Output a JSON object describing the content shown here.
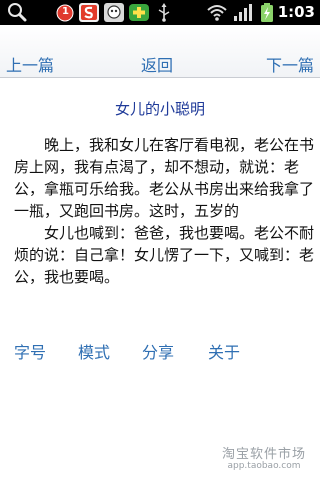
{
  "status_bar": {
    "time": "1:03",
    "notification_count": "1",
    "icons": [
      "search-icon",
      "notification-badge-icon",
      "sohu-app-icon",
      "robot-app-icon",
      "plus-app-icon",
      "usb-icon",
      "wifi-icon",
      "signal-icon",
      "battery-charging-icon"
    ]
  },
  "nav": {
    "prev": "上一篇",
    "back": "返回",
    "next": "下一篇"
  },
  "article": {
    "title": "女儿的小聪明",
    "paragraphs": [
      "晚上，我和女儿在客厅看电视，老公在书房上网，我有点渴了，却不想动，就说：老公，拿瓶可乐给我。老公从书房出来给我拿了一瓶，又跑回书房。这时，五岁的",
      "女儿也喊到：爸爸，我也要喝。老公不耐烦的说：自己拿！女儿愣了一下，又喊到：老公，我也要喝。"
    ]
  },
  "menu": {
    "font": "字号",
    "mode": "模式",
    "share": "分享",
    "about": "关于"
  },
  "watermark": {
    "name": "淘宝软件市场",
    "url": "app.taobao.com"
  },
  "colors": {
    "link": "#2f6fb3",
    "title": "#1f3a99",
    "status_bar": "#000000"
  }
}
